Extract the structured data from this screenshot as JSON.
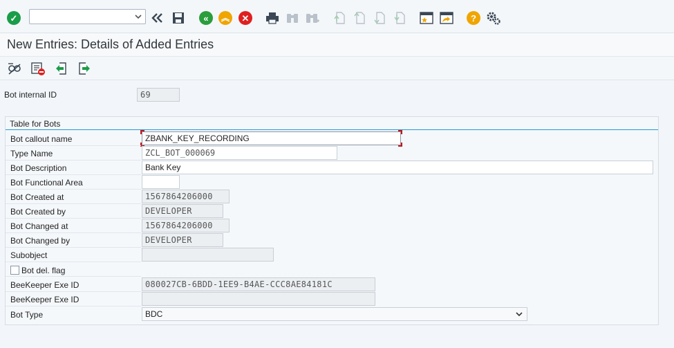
{
  "toolbar": {
    "command_field_value": "",
    "icons": [
      "enter-check-icon",
      "command-field",
      "back-double-icon",
      "save-icon",
      "back-icon",
      "exit-icon",
      "cancel-icon",
      "print-icon",
      "find-icon",
      "find-next-icon",
      "first-page-icon",
      "previous-page-icon",
      "next-page-icon",
      "last-page-icon",
      "create-session-icon",
      "shortcut-icon",
      "help-icon",
      "settings-icon"
    ]
  },
  "page": {
    "title": "New Entries: Details of Added Entries"
  },
  "subtoolbar": {
    "icons": [
      "display-change-icon",
      "delete-entry-icon",
      "previous-entry-icon",
      "next-entry-icon"
    ]
  },
  "header_field": {
    "label": "Bot internal ID",
    "value": "69"
  },
  "group": {
    "title": "Table for Bots",
    "fields": [
      {
        "label": "Bot callout name",
        "value": "ZBANK_KEY_RECORDING"
      },
      {
        "label": "Type Name",
        "value": "ZCL_BOT_000069"
      },
      {
        "label": "Bot Description",
        "value": "Bank Key"
      },
      {
        "label": "Bot Functional Area",
        "value": ""
      },
      {
        "label": "Bot Created at",
        "value": "1567864206000"
      },
      {
        "label": "Bot Created by",
        "value": "DEVELOPER"
      },
      {
        "label": "Bot Changed at",
        "value": "1567864206000"
      },
      {
        "label": "Bot Changed by",
        "value": "DEVELOPER"
      },
      {
        "label": "Subobject",
        "value": ""
      },
      {
        "label": "Bot del. flag",
        "value": ""
      },
      {
        "label": "BeeKeeper Exe ID",
        "value": "080027CB-6BDD-1EE9-B4AE-CCC8AE84181C"
      },
      {
        "label": "BeeKeeper Exe ID",
        "value": ""
      },
      {
        "label": "Bot Type",
        "value": "BDC"
      }
    ]
  },
  "colors": {
    "accent": "#1b9ad8",
    "check": "#1a9d48",
    "back": "#2a9d3c",
    "exit": "#f0a500",
    "cancel": "#e02020",
    "focus": "#c4161c"
  }
}
